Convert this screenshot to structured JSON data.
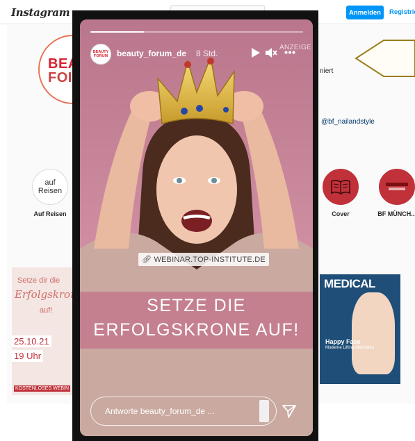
{
  "topbar": {
    "logo": "Instagram",
    "login_label": "Anmelden",
    "register_label": "Registrie"
  },
  "profile": {
    "avatar_text": "BEAUTY FORUM",
    "avatar_line1": "BEA",
    "avatar_line2": "FOI",
    "bio_tail": "niert",
    "bio_link": "@bf_nailandstyle"
  },
  "highlights": [
    {
      "label": "Auf Reisen",
      "inner": "auf Reisen"
    },
    {
      "label": "Cover",
      "inner": ""
    },
    {
      "label": "BF MÜNCH...",
      "inner": ""
    }
  ],
  "post_left": {
    "title": "Setze dir die",
    "script": "Erfolgskrone",
    "auf": "auf!",
    "date": "25.10.21",
    "time": "19 Uhr",
    "free": "KOSTENLOSES WEBIN"
  },
  "post_right": {
    "title": "MEDICAL",
    "happy": "Happy Face",
    "sub": "Moderne Lifting-Methoden"
  },
  "story": {
    "username": "beauty_forum_de",
    "time": "8 Std.",
    "ad_label": "ANZEIGE",
    "avatar_text": "BEAUTY FORUM",
    "progress": 0.25,
    "link_label": "WEBINAR.TOP-INSTITUTE.DE",
    "headline_line1": "SETZE DIE",
    "headline_line2": "ERFOLGSKRONE AUF!",
    "reply_placeholder": "Antworte beauty_forum_de ...",
    "icons": [
      "play-icon",
      "mute-icon",
      "more-icon",
      "send-icon",
      "link-icon"
    ]
  },
  "colors": {
    "accent_blue": "#0095f6",
    "story_pink": "#c48496",
    "brand_red": "#d9232f"
  }
}
